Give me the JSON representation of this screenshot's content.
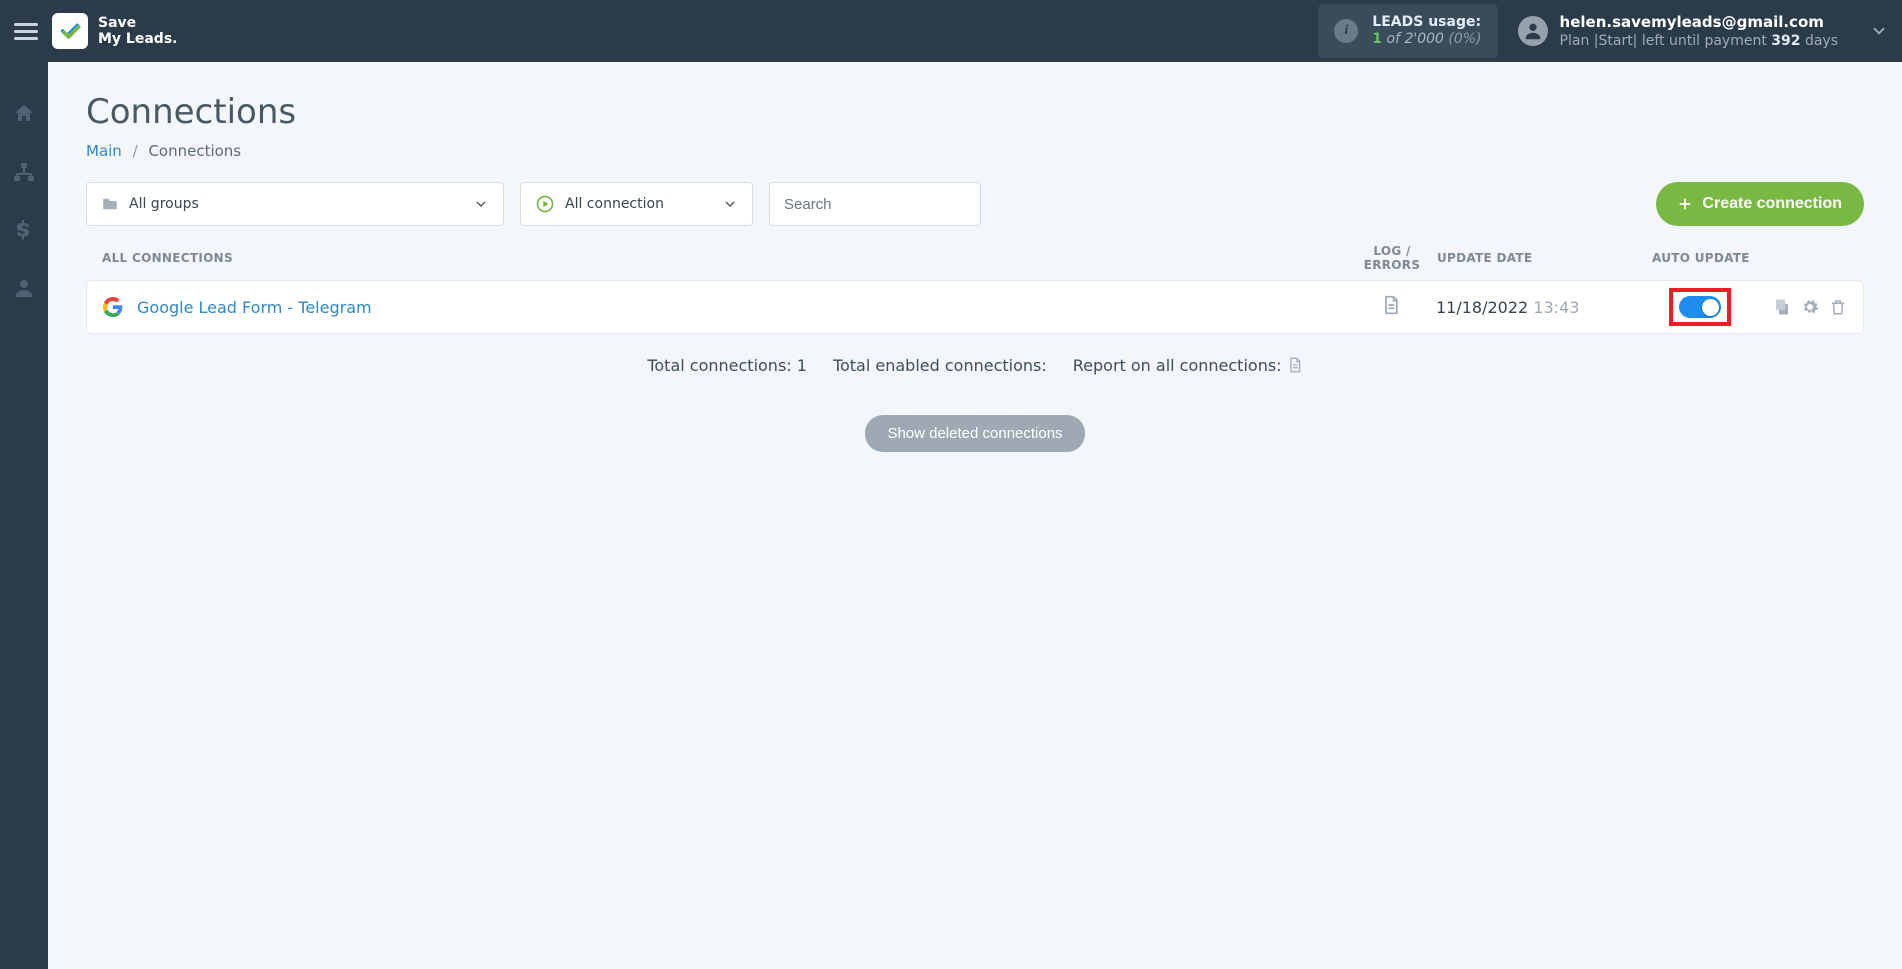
{
  "brand": {
    "line1": "Save",
    "line2": "My Leads."
  },
  "leads_usage": {
    "label": "LEADS usage:",
    "used": "1",
    "of_word": "of",
    "total": "2'000",
    "pct": "(0%)"
  },
  "user": {
    "email": "helen.savemyleads@gmail.com",
    "plan_prefix": "Plan |Start|  left until payment ",
    "plan_days": "392",
    "plan_suffix": " days"
  },
  "page": {
    "title": "Connections",
    "breadcrumb": {
      "root": "Main",
      "current": "Connections"
    }
  },
  "filters": {
    "groups": "All groups",
    "connection": "All connection",
    "search_placeholder": "Search",
    "create_label": "Create connection"
  },
  "table": {
    "headers": {
      "name": "ALL CONNECTIONS",
      "log": "LOG / ERRORS",
      "date": "UPDATE DATE",
      "auto": "AUTO UPDATE"
    },
    "rows": [
      {
        "name": "Google Lead Form - Telegram",
        "date": "11/18/2022",
        "time": "13:43",
        "auto_on": true
      }
    ]
  },
  "summary": {
    "total_conns": "Total connections: 1",
    "total_enabled": "Total enabled connections:",
    "report": "Report on all connections:"
  },
  "deleted_btn": "Show deleted connections"
}
